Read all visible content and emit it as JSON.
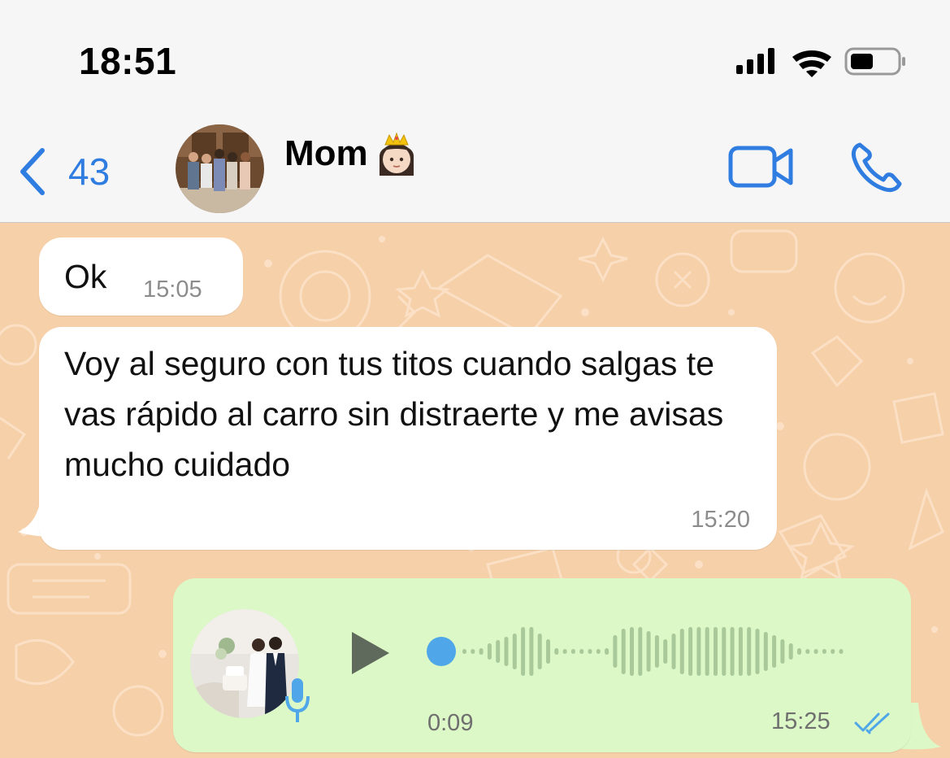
{
  "status_bar": {
    "time": "18:51"
  },
  "header": {
    "back_count": "43",
    "contact_name": "Mom",
    "contact_emoji": "crown-princess-emoji"
  },
  "messages": [
    {
      "direction": "incoming",
      "text": "Ok",
      "time": "15:05"
    },
    {
      "direction": "incoming",
      "text": "Voy al seguro con tus titos cuando salgas te vas rápido al carro sin distraerte y me avisas mucho cuidado",
      "time": "15:20"
    },
    {
      "direction": "outgoing",
      "type": "voice",
      "duration": "0:09",
      "time": "15:25",
      "status": "read",
      "played": false
    }
  ],
  "icons": [
    "back-chevron-icon",
    "video-call-icon",
    "phone-icon",
    "signal-icon",
    "wifi-icon",
    "battery-icon",
    "play-icon",
    "microphone-icon",
    "double-check-icon"
  ],
  "colors": {
    "accent": "#2f7de1",
    "chat_background": "#f6d0a8",
    "outgoing_bubble": "#dcf8c6",
    "incoming_bubble": "#ffffff",
    "read_ticks": "#4fa6e8",
    "waveform": "#a9c99a"
  }
}
